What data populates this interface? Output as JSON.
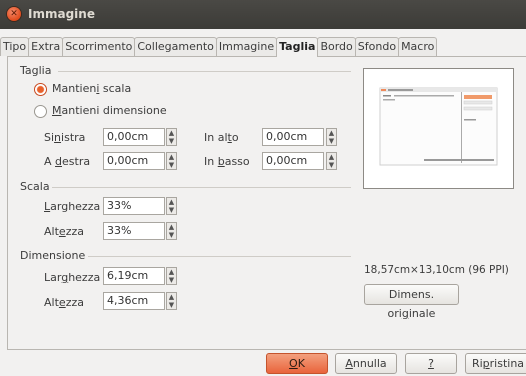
{
  "window": {
    "title": "Immagine"
  },
  "tabs": [
    "Tipo",
    "Extra",
    "Scorrimento",
    "Collegamento",
    "Immagine",
    "Taglia",
    "Bordo",
    "Sfondo",
    "Macro"
  ],
  "active_tab": "Taglia",
  "crop": {
    "section": "Taglia",
    "keep_scale": {
      "pre": "Mantien",
      "u": "i",
      "post": " scala"
    },
    "keep_size": {
      "pre": "",
      "u": "M",
      "post": "antieni dimensione"
    },
    "left": {
      "pre": "Si",
      "u": "n",
      "post": "istra",
      "value": "0,00cm"
    },
    "right": {
      "pre": "A ",
      "u": "d",
      "post": "estra",
      "value": "0,00cm"
    },
    "top": {
      "pre": "In al",
      "u": "t",
      "post": "o",
      "value": "0,00cm"
    },
    "bottom": {
      "pre": "In ",
      "u": "b",
      "post": "asso",
      "value": "0,00cm"
    }
  },
  "scale": {
    "section": "Scala",
    "width": {
      "pre": "",
      "u": "L",
      "post": "arghezza",
      "value": "33%"
    },
    "height": {
      "pre": "Alt",
      "u": "e",
      "post": "zza",
      "value": "33%"
    }
  },
  "size": {
    "section": "Dimensione",
    "width": {
      "pre": "Lar",
      "u": "g",
      "post": "hezza",
      "value": "6,19cm"
    },
    "height": {
      "pre": "Alt",
      "u": "e",
      "post": "zza",
      "value": "4,36cm"
    }
  },
  "original": {
    "info": "18,57cm×13,10cm (96 PPI)",
    "btn_pre": "Dimens. ori",
    "btn_u": "g",
    "btn_post": "inale"
  },
  "buttons": {
    "ok": {
      "pre": "",
      "u": "O",
      "post": "K"
    },
    "cancel": {
      "pre": "",
      "u": "A",
      "post": "nnulla"
    },
    "help": {
      "pre": "",
      "u": "?",
      "post": ""
    },
    "reset": {
      "pre": "Ri",
      "u": "p",
      "post": "ristina"
    }
  },
  "spin_up": "▲",
  "spin_down": "▼"
}
